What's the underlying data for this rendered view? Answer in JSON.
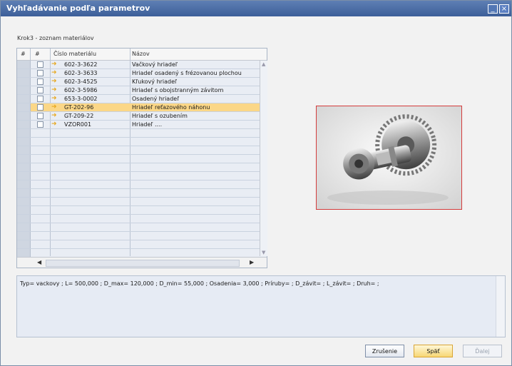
{
  "window": {
    "title": "Vyhľadávanie podľa parametrov"
  },
  "step_label": "Krok3 - zoznam materiálov",
  "grid": {
    "columns": [
      "#",
      "#",
      "Číslo materiálu",
      "Názov"
    ],
    "rows": [
      {
        "number": "602-3-3622",
        "name": "Vačkový hriadeľ"
      },
      {
        "number": "602-3-3633",
        "name": "Hriadeľ osadený s frézovanou plochou"
      },
      {
        "number": "602-3-4525",
        "name": "Kľukový hriadeľ"
      },
      {
        "number": "602-3-5986",
        "name": "Hriadeľ s obojstranným závitom"
      },
      {
        "number": "653-3-0002",
        "name": "Osadený hriadeľ"
      },
      {
        "number": "GT-202-96",
        "name": "Hriadeľ reťazového náhonu"
      },
      {
        "number": "GT-209-22",
        "name": "Hriadeľ s ozubením"
      },
      {
        "number": "VZOR001",
        "name": "Hriadeľ ...."
      }
    ],
    "selected_row_index": 5
  },
  "description": "Typ= vackovy ; L= 500,000 ; D_max= 120,000 ; D_min= 55,000 ; Osadenia= 3,000 ; Príruby= ; D_závit= ; L_závit= ; Druh= ;",
  "buttons": {
    "cancel": "Zrušenie",
    "back": "Späť",
    "next": "Ďalej"
  },
  "colors": {
    "title_bar": "#4a6ca6",
    "selected_row": "#fbd787",
    "image_border": "#d43c3c"
  },
  "icons": {
    "row_link": "arrow-right-icon",
    "minimize": "minimize-icon",
    "close": "close-icon"
  }
}
